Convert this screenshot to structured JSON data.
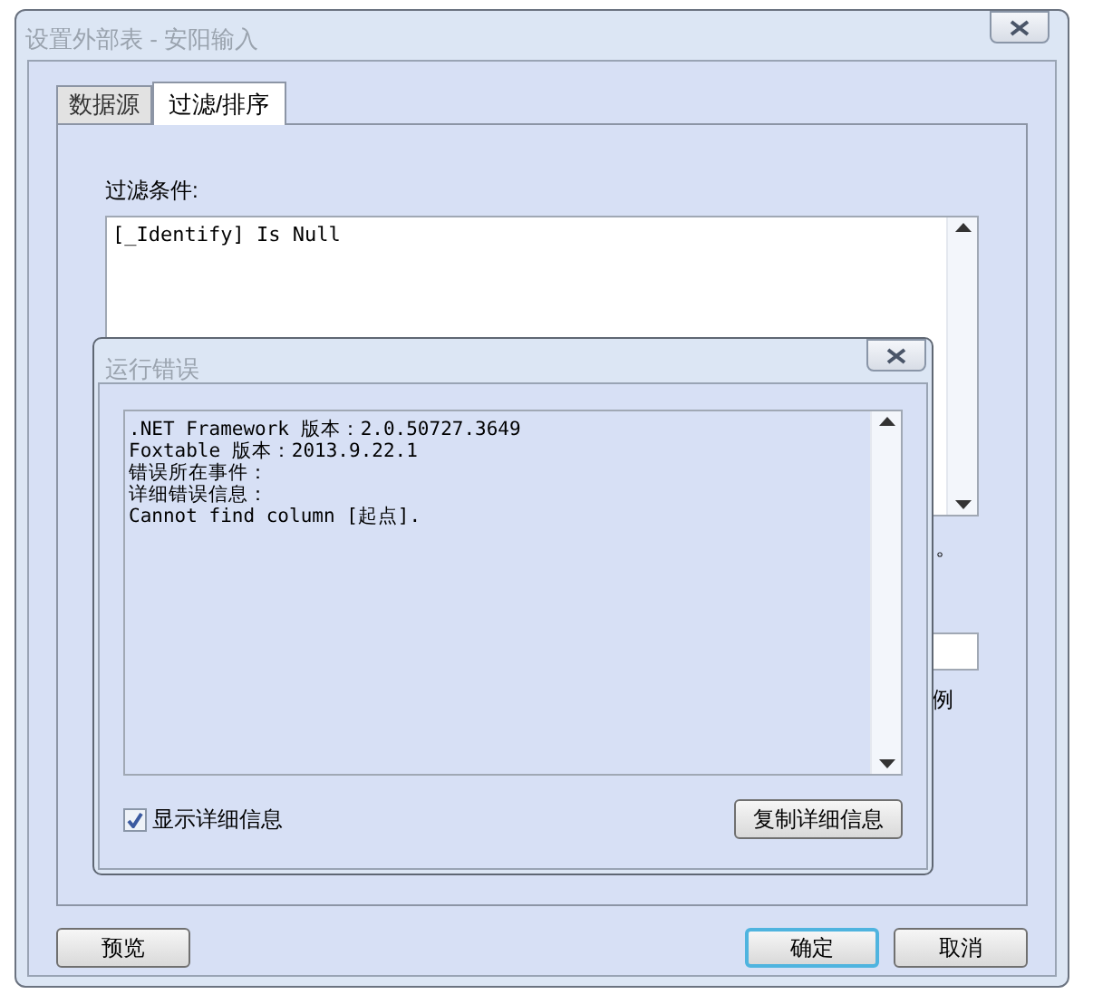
{
  "window": {
    "title": "设置外部表 - 安阳输入"
  },
  "tabs": [
    {
      "label": "数据源",
      "selected": false
    },
    {
      "label": "过滤/排序",
      "selected": true
    }
  ],
  "filter": {
    "label": "过滤条件:",
    "value": "[_Identify] Is Null"
  },
  "covered_texts": [
    "。",
    "例"
  ],
  "error_dialog": {
    "title": "运行错误",
    "lines": [
      ".NET Framework 版本：2.0.50727.3649",
      "Foxtable 版本：2013.9.22.1",
      "错误所在事件：",
      "详细错误信息：",
      "Cannot find column [起点]."
    ],
    "show_details": {
      "label": "显示详细信息",
      "checked": true
    },
    "copy_button": "复制详细信息"
  },
  "buttons": [
    {
      "label": "预览",
      "default": false
    },
    {
      "label": "确定",
      "default": true
    },
    {
      "label": "取消",
      "default": false
    }
  ]
}
